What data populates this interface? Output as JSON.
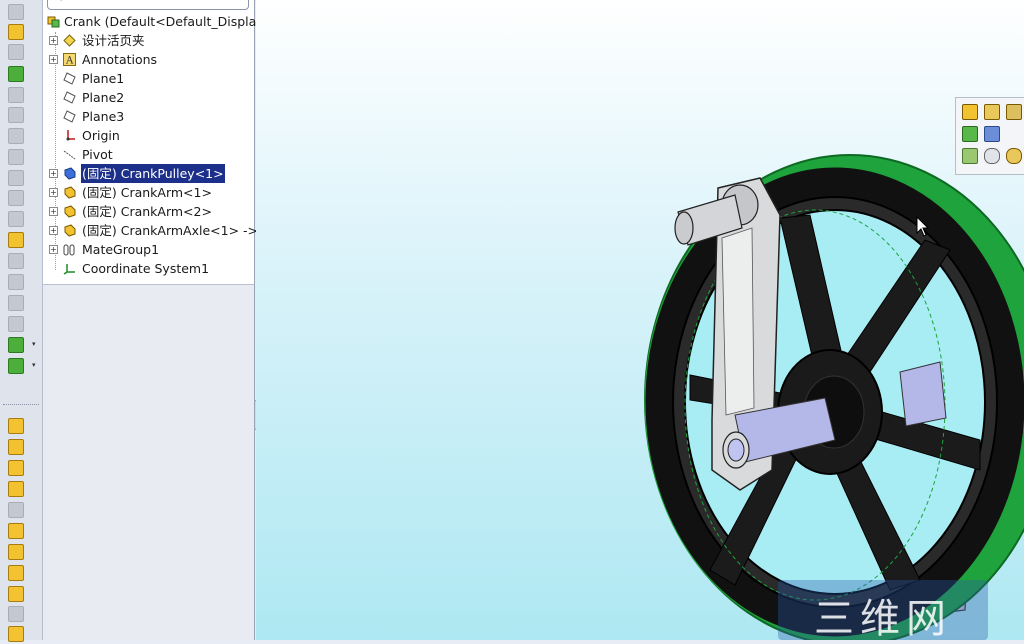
{
  "feature_tree": {
    "root": {
      "label": "Crank  (Default<Default_Display"
    },
    "items": [
      {
        "label": "设计活页夹",
        "icon": "design-binder-icon",
        "expandable": true
      },
      {
        "label": "Annotations",
        "icon": "annotations-icon",
        "expandable": true
      },
      {
        "label": "Plane1",
        "icon": "plane-icon",
        "expandable": false
      },
      {
        "label": "Plane2",
        "icon": "plane-icon",
        "expandable": false
      },
      {
        "label": "Plane3",
        "icon": "plane-icon",
        "expandable": false
      },
      {
        "label": "Origin",
        "icon": "origin-icon",
        "expandable": false
      },
      {
        "label": "Pivot",
        "icon": "axis-icon",
        "expandable": false
      },
      {
        "label": "(固定) CrankPulley<1>",
        "icon": "part-icon",
        "expandable": true,
        "selected": true
      },
      {
        "label": "(固定) CrankArm<1>",
        "icon": "part-icon",
        "expandable": true
      },
      {
        "label": "(固定) CrankArm<2>",
        "icon": "part-icon",
        "expandable": true
      },
      {
        "label": "(固定) CrankArmAxle<1> ->",
        "icon": "part-icon",
        "expandable": true
      },
      {
        "label": "MateGroup1",
        "icon": "mates-icon",
        "expandable": true
      },
      {
        "label": "Coordinate System1",
        "icon": "coordinate-system-icon",
        "expandable": false
      }
    ]
  },
  "watermark": {
    "text": "三维网"
  },
  "colors": {
    "selection": "#1c2f8a",
    "pulley_rim": "#1fa33c",
    "pulley_body": "#1a1a1a",
    "arm": "#d8dadc",
    "axle": "#b4b8e8"
  }
}
